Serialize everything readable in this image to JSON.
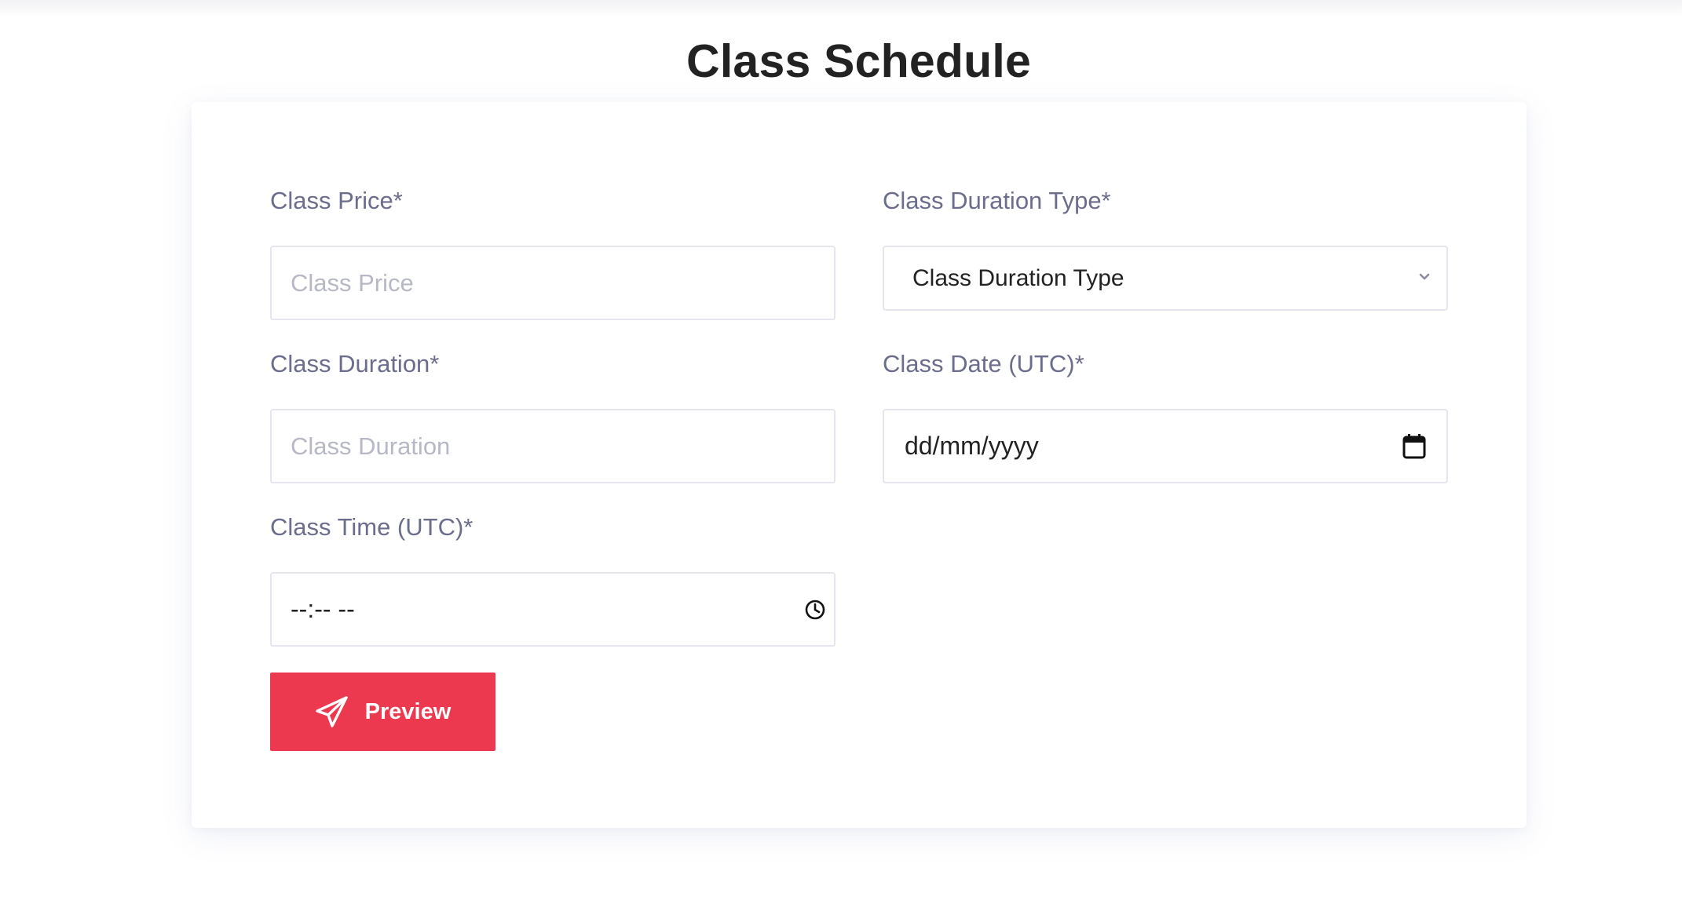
{
  "page": {
    "title": "Class Schedule"
  },
  "form": {
    "class_price": {
      "label": "Class Price*",
      "placeholder": "Class Price"
    },
    "class_duration_type": {
      "label": "Class Duration Type*",
      "selected": "Class Duration Type"
    },
    "class_duration": {
      "label": "Class Duration*",
      "placeholder": "Class Duration"
    },
    "class_date": {
      "label": "Class Date (UTC)*",
      "value": "dd/mm/yyyy"
    },
    "class_time": {
      "label": "Class Time (UTC)*",
      "value": "--:-- --"
    },
    "preview_button": {
      "label": "Preview",
      "icon": "paper-plane-icon"
    }
  },
  "colors": {
    "accent": "#ec394f",
    "label": "#6c6d8c",
    "title": "#222222"
  }
}
